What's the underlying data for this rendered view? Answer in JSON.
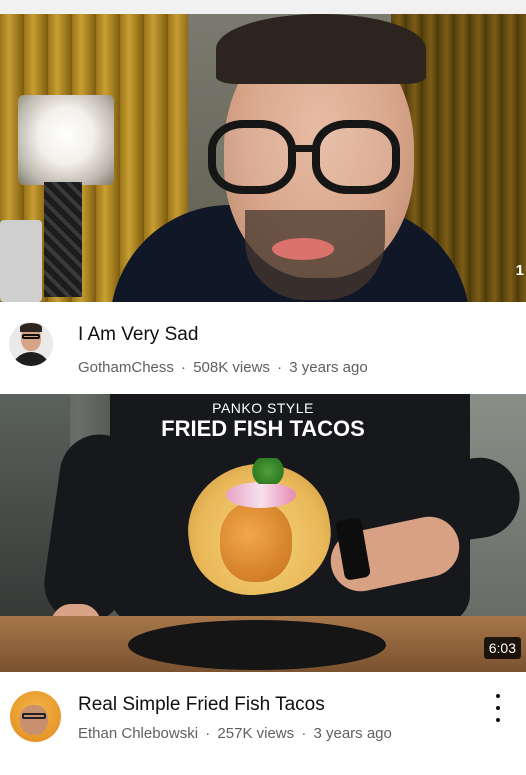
{
  "videos": [
    {
      "title": "I Am Very Sad",
      "channel": "GothamChess",
      "views": "508K views",
      "age": "3 years ago",
      "thumbnail_corner_text": "1"
    },
    {
      "title": "Real Simple Fried Fish Tacos",
      "channel": "Ethan Chlebowski",
      "views": "257K views",
      "age": "3 years ago",
      "thumbnail_overlay_small": "PANKO STYLE",
      "thumbnail_overlay_big": "FRIED FISH TACOS",
      "duration": "6:03"
    }
  ],
  "separator": "·",
  "icons": {
    "more_menu": "vertical-ellipsis-icon"
  }
}
